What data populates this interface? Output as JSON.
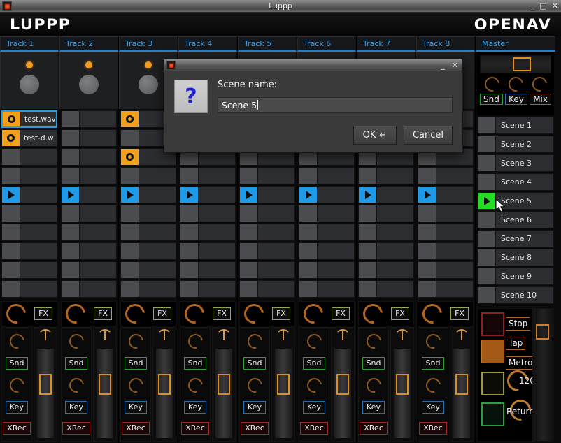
{
  "window": {
    "title": "Luppp",
    "app_icon": "app-icon",
    "minimize": "_",
    "maximize": "□",
    "close": "✕"
  },
  "header": {
    "logo_left": "LUPPP",
    "logo_right": "OPENAV"
  },
  "tracks": [
    {
      "label": "Track 1",
      "clips": [
        {
          "state": "loaded",
          "name": "test.wav",
          "selected": true
        },
        {
          "state": "loaded",
          "name": "test-d.w",
          "selected": false
        },
        {
          "state": "empty",
          "name": "",
          "selected": false
        },
        {
          "state": "empty",
          "name": "",
          "selected": false
        },
        {
          "state": "play",
          "name": "",
          "selected": false
        },
        {
          "state": "empty",
          "name": "",
          "selected": false
        },
        {
          "state": "empty",
          "name": "",
          "selected": false
        },
        {
          "state": "empty",
          "name": "",
          "selected": false
        },
        {
          "state": "empty",
          "name": "",
          "selected": false
        },
        {
          "state": "empty",
          "name": "",
          "selected": false
        }
      ]
    },
    {
      "label": "Track 2",
      "clips": [
        {
          "state": "empty",
          "name": "",
          "selected": false
        },
        {
          "state": "empty",
          "name": "",
          "selected": false
        },
        {
          "state": "empty",
          "name": "",
          "selected": false
        },
        {
          "state": "empty",
          "name": "",
          "selected": false
        },
        {
          "state": "play",
          "name": "",
          "selected": false
        },
        {
          "state": "empty",
          "name": "",
          "selected": false
        },
        {
          "state": "empty",
          "name": "",
          "selected": false
        },
        {
          "state": "empty",
          "name": "",
          "selected": false
        },
        {
          "state": "empty",
          "name": "",
          "selected": false
        },
        {
          "state": "empty",
          "name": "",
          "selected": false
        }
      ]
    },
    {
      "label": "Track 3",
      "clips": [
        {
          "state": "loaded",
          "name": "",
          "selected": false
        },
        {
          "state": "empty",
          "name": "",
          "selected": false
        },
        {
          "state": "loaded",
          "name": "",
          "selected": false
        },
        {
          "state": "empty",
          "name": "",
          "selected": false
        },
        {
          "state": "play",
          "name": "",
          "selected": false
        },
        {
          "state": "empty",
          "name": "",
          "selected": false
        },
        {
          "state": "empty",
          "name": "",
          "selected": false
        },
        {
          "state": "empty",
          "name": "",
          "selected": false
        },
        {
          "state": "empty",
          "name": "",
          "selected": false
        },
        {
          "state": "empty",
          "name": "",
          "selected": false
        }
      ]
    },
    {
      "label": "Track 4",
      "clips": [
        {
          "state": "empty",
          "name": "",
          "selected": false
        },
        {
          "state": "empty",
          "name": "",
          "selected": false
        },
        {
          "state": "empty",
          "name": "",
          "selected": false
        },
        {
          "state": "empty",
          "name": "",
          "selected": false
        },
        {
          "state": "play",
          "name": "",
          "selected": false
        },
        {
          "state": "empty",
          "name": "",
          "selected": false
        },
        {
          "state": "empty",
          "name": "",
          "selected": false
        },
        {
          "state": "empty",
          "name": "",
          "selected": false
        },
        {
          "state": "empty",
          "name": "",
          "selected": false
        },
        {
          "state": "empty",
          "name": "",
          "selected": false
        }
      ]
    },
    {
      "label": "Track 5",
      "clips": [
        {
          "state": "empty",
          "name": "",
          "selected": false
        },
        {
          "state": "empty",
          "name": "",
          "selected": false
        },
        {
          "state": "empty",
          "name": "",
          "selected": false
        },
        {
          "state": "empty",
          "name": "",
          "selected": false
        },
        {
          "state": "play",
          "name": "",
          "selected": false
        },
        {
          "state": "empty",
          "name": "",
          "selected": false
        },
        {
          "state": "empty",
          "name": "",
          "selected": false
        },
        {
          "state": "empty",
          "name": "",
          "selected": false
        },
        {
          "state": "empty",
          "name": "",
          "selected": false
        },
        {
          "state": "empty",
          "name": "",
          "selected": false
        }
      ]
    },
    {
      "label": "Track 6",
      "clips": [
        {
          "state": "empty",
          "name": "",
          "selected": false
        },
        {
          "state": "empty",
          "name": "",
          "selected": false
        },
        {
          "state": "empty",
          "name": "",
          "selected": false
        },
        {
          "state": "empty",
          "name": "",
          "selected": false
        },
        {
          "state": "play",
          "name": "",
          "selected": false
        },
        {
          "state": "empty",
          "name": "",
          "selected": false
        },
        {
          "state": "empty",
          "name": "",
          "selected": false
        },
        {
          "state": "empty",
          "name": "",
          "selected": false
        },
        {
          "state": "empty",
          "name": "",
          "selected": false
        },
        {
          "state": "empty",
          "name": "",
          "selected": false
        }
      ]
    },
    {
      "label": "Track 7",
      "clips": [
        {
          "state": "empty",
          "name": "",
          "selected": false
        },
        {
          "state": "empty",
          "name": "",
          "selected": false
        },
        {
          "state": "empty",
          "name": "",
          "selected": false
        },
        {
          "state": "empty",
          "name": "",
          "selected": false
        },
        {
          "state": "play",
          "name": "",
          "selected": false
        },
        {
          "state": "empty",
          "name": "",
          "selected": false
        },
        {
          "state": "empty",
          "name": "",
          "selected": false
        },
        {
          "state": "empty",
          "name": "",
          "selected": false
        },
        {
          "state": "empty",
          "name": "",
          "selected": false
        },
        {
          "state": "empty",
          "name": "",
          "selected": false
        }
      ]
    },
    {
      "label": "Track 8",
      "clips": [
        {
          "state": "empty",
          "name": "",
          "selected": false
        },
        {
          "state": "empty",
          "name": "",
          "selected": false
        },
        {
          "state": "empty",
          "name": "",
          "selected": false
        },
        {
          "state": "empty",
          "name": "",
          "selected": false
        },
        {
          "state": "play",
          "name": "",
          "selected": false
        },
        {
          "state": "empty",
          "name": "",
          "selected": false
        },
        {
          "state": "empty",
          "name": "",
          "selected": false
        },
        {
          "state": "empty",
          "name": "",
          "selected": false
        },
        {
          "state": "empty",
          "name": "",
          "selected": false
        },
        {
          "state": "empty",
          "name": "",
          "selected": false
        }
      ]
    }
  ],
  "track_controls": {
    "fx_label": "FX",
    "send_label": "Snd",
    "key_label": "Key",
    "xrec_label": "XRec"
  },
  "master": {
    "label": "Master",
    "send_label": "Snd",
    "key_label": "Key",
    "mix_label": "Mix",
    "scenes": [
      {
        "name": "Scene 1",
        "active": false
      },
      {
        "name": "Scene 2",
        "active": false
      },
      {
        "name": "Scene 3",
        "active": false
      },
      {
        "name": "Scene 4",
        "active": false
      },
      {
        "name": "Scene 5",
        "active": true
      },
      {
        "name": "Scene 6",
        "active": false
      },
      {
        "name": "Scene 7",
        "active": false
      },
      {
        "name": "Scene 8",
        "active": false
      },
      {
        "name": "Scene 9",
        "active": false
      },
      {
        "name": "Scene 10",
        "active": false
      }
    ],
    "transport": {
      "stop_label": "Stop",
      "tap_label": "Tap",
      "metronome_label": "Metro",
      "bpm_value": "120",
      "return_label": "Return"
    }
  },
  "dialog": {
    "icon": "question-icon",
    "icon_glyph": "?",
    "minimize": "_",
    "close": "✕",
    "label": "Scene name:",
    "input_value": "Scene 5",
    "input_placeholder": "",
    "ok_label": "OK",
    "ok_glyph": "↵",
    "cancel_label": "Cancel"
  },
  "colors": {
    "accent_blue": "#3f9fe0",
    "clip_loaded": "#f2a01e",
    "clip_play": "#1f9ae8",
    "scene_active": "#22dd22",
    "orange": "#e08c1e",
    "send_green": "#2d9e3c",
    "rec_red": "#a12626"
  }
}
